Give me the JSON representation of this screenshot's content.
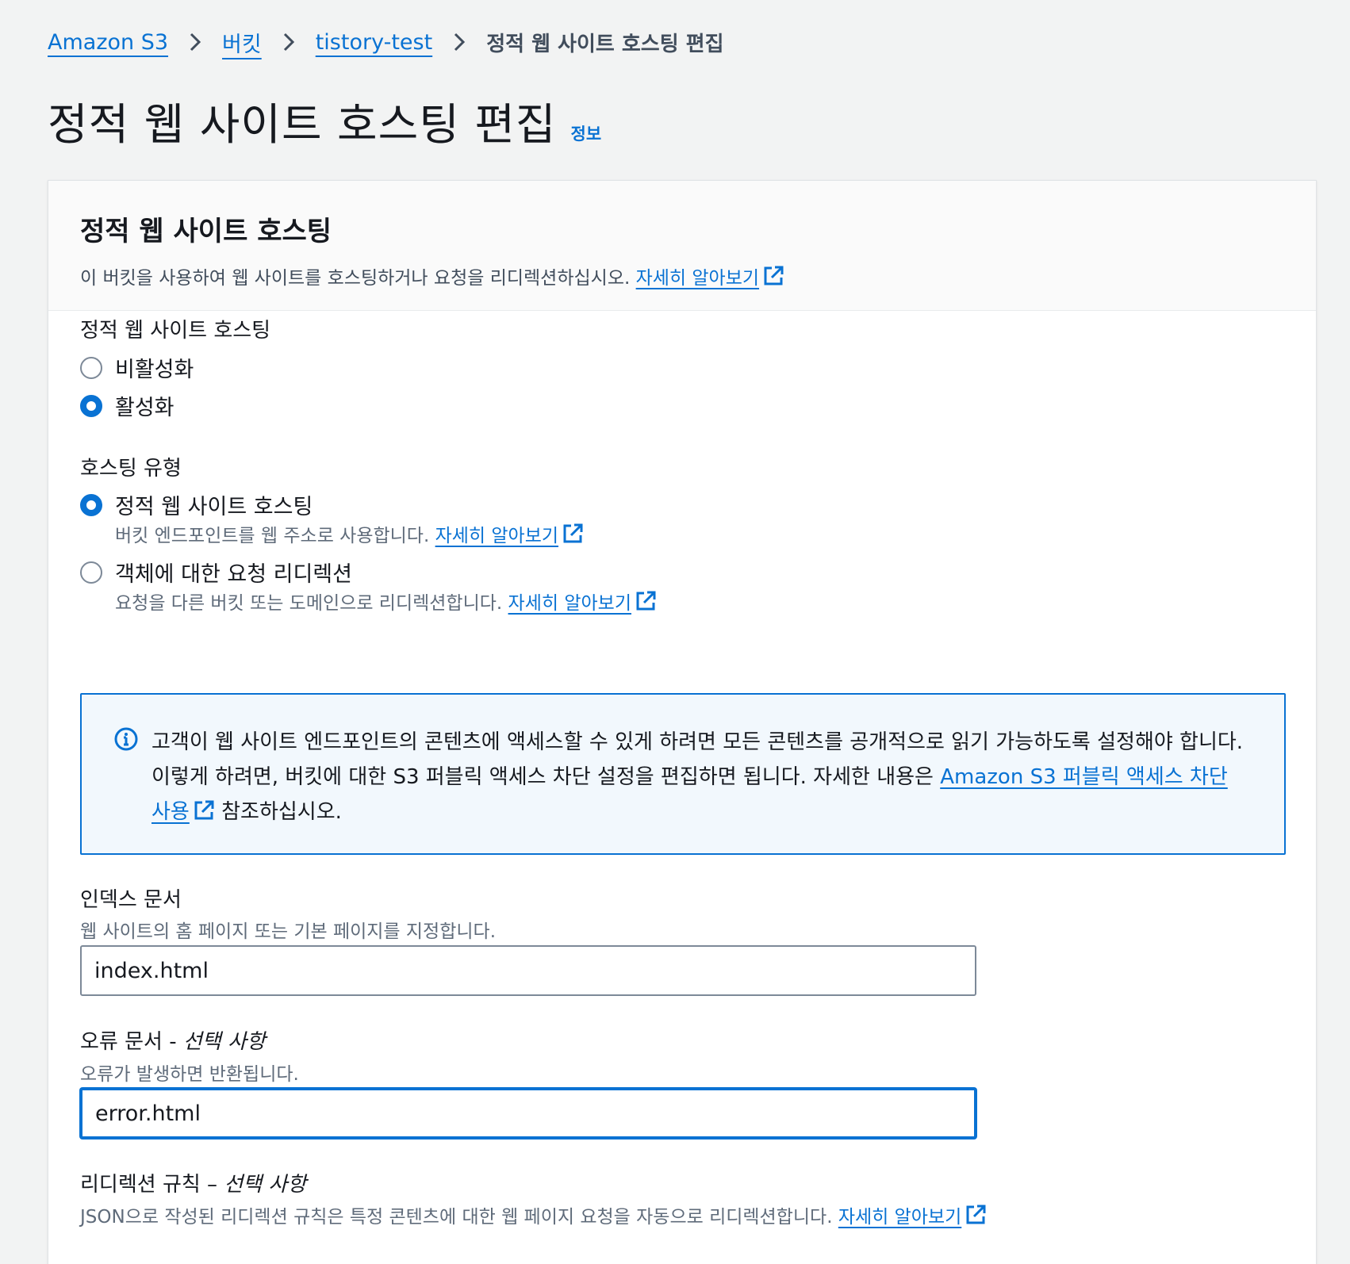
{
  "breadcrumb": {
    "items": [
      "Amazon S3",
      "버킷",
      "tistory-test"
    ],
    "current": "정적 웹 사이트 호스팅 편집"
  },
  "page": {
    "title": "정적 웹 사이트 호스팅 편집",
    "info_link": "정보"
  },
  "panel": {
    "title": "정적 웹 사이트 호스팅",
    "description": "이 버킷을 사용하여 웹 사이트를 호스팅하거나 요청을 리디렉션하십시오.",
    "learn_more": "자세히 알아보기"
  },
  "hosting": {
    "label": "정적 웹 사이트 호스팅",
    "options": [
      {
        "label": "비활성화",
        "selected": false
      },
      {
        "label": "활성화",
        "selected": true
      }
    ]
  },
  "hosting_type": {
    "label": "호스팅 유형",
    "options": [
      {
        "label": "정적 웹 사이트 호스팅",
        "description": "버킷 엔드포인트를 웹 주소로 사용합니다.",
        "learn_more": "자세히 알아보기",
        "selected": true
      },
      {
        "label": "객체에 대한 요청 리디렉션",
        "description": "요청을 다른 버킷 또는 도메인으로 리디렉션합니다.",
        "learn_more": "자세히 알아보기",
        "selected": false
      }
    ]
  },
  "alert": {
    "text_before": "고객이 웹 사이트 엔드포인트의 콘텐츠에 액세스할 수 있게 하려면 모든 콘텐츠를 공개적으로 읽기 가능하도록 설정해야 합니다. 이렇게 하려면, 버킷에 대한 S3 퍼블릭 액세스 차단 설정을 편집하면 됩니다. 자세한 내용은 ",
    "link": "Amazon S3 퍼블릭 액세스 차단 사용",
    "text_after": " 참조하십시오."
  },
  "index_document": {
    "label": "인덱스 문서",
    "description": "웹 사이트의 홈 페이지 또는 기본 페이지를 지정합니다.",
    "value": "index.html"
  },
  "error_document": {
    "label": "오류 문서 - ",
    "optional": "선택 사항",
    "description": "오류가 발생하면 반환됩니다.",
    "value": "error.html"
  },
  "redirect_rules": {
    "label": "리디렉션 규칙 – ",
    "optional": "선택 사항",
    "description": "JSON으로 작성된 리디렉션 규칙은 특정 콘텐츠에 대한 웹 페이지 요청을 자동으로 리디렉션합니다.",
    "learn_more": "자세히 알아보기"
  },
  "icons": {
    "chevron": "chevron-right-icon",
    "external": "external-link-icon",
    "info": "info-circle-icon"
  },
  "colors": {
    "link": "#0972d3",
    "background": "#f2f3f3",
    "alert_bg": "#f2f8fd"
  }
}
